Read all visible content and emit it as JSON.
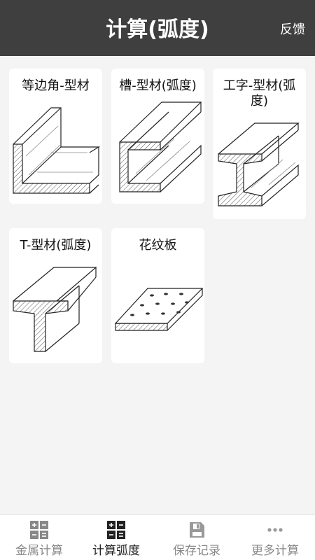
{
  "header": {
    "title": "计算(弧度)",
    "feedback_label": "反馈"
  },
  "cards": [
    {
      "label": "等边角-型材"
    },
    {
      "label": "槽-型材(弧度)"
    },
    {
      "label": "工字-型材(弧度)"
    },
    {
      "label": "T-型材(弧度)"
    },
    {
      "label": "花纹板"
    }
  ],
  "tabs": [
    {
      "label": "金属计算",
      "icon": "calculator-icon",
      "active": false
    },
    {
      "label": "计算弧度",
      "icon": "calculator-icon",
      "active": true
    },
    {
      "label": "保存记录",
      "icon": "save-icon",
      "active": false
    },
    {
      "label": "更多计算",
      "icon": "more-dots-icon",
      "active": false
    }
  ],
  "colors": {
    "header_bg": "#3f3f3f",
    "active_tab": "#222222",
    "inactive_tab": "#888888"
  }
}
